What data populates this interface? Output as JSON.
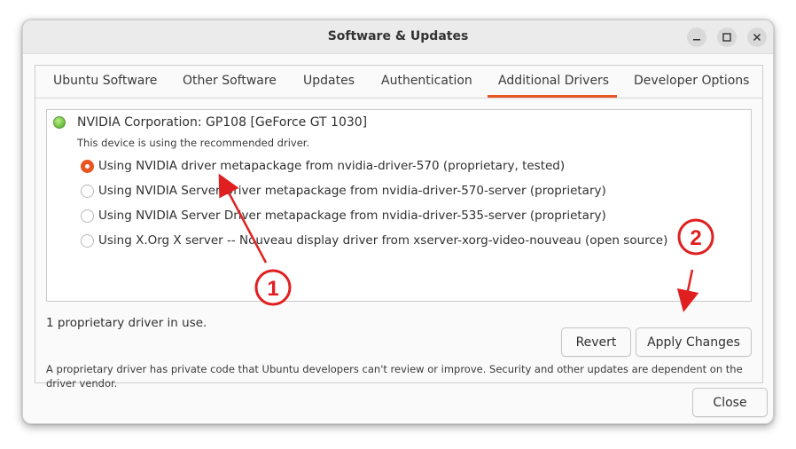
{
  "window": {
    "title": "Software & Updates"
  },
  "tabs": [
    {
      "label": "Ubuntu Software"
    },
    {
      "label": "Other Software"
    },
    {
      "label": "Updates"
    },
    {
      "label": "Authentication"
    },
    {
      "label": "Additional Drivers",
      "selected": true
    },
    {
      "label": "Developer Options"
    }
  ],
  "device": {
    "name": "NVIDIA Corporation: GP108 [GeForce GT 1030]",
    "status": "This device is using the recommended driver.",
    "status_led_color": "#78c74a"
  },
  "driver_options": [
    {
      "label": "Using NVIDIA driver metapackage from nvidia-driver-570 (proprietary, tested)",
      "selected": true
    },
    {
      "label": "Using NVIDIA Server Driver metapackage from nvidia-driver-570-server (proprietary)",
      "selected": false
    },
    {
      "label": "Using NVIDIA Server Driver metapackage from nvidia-driver-535-server (proprietary)",
      "selected": false
    },
    {
      "label": "Using X.Org X server -- Nouveau display driver from xserver-xorg-video-nouveau (open source)",
      "selected": false
    }
  ],
  "status_text": "1 proprietary driver in use.",
  "buttons": {
    "revert": "Revert",
    "apply": "Apply Changes",
    "close": "Close"
  },
  "footnote": "A proprietary driver has private code that Ubuntu developers can't review or improve. Security and other updates are dependent on the driver vendor.",
  "annotations": [
    {
      "label": "1"
    },
    {
      "label": "2"
    }
  ],
  "colors": {
    "accent": "#e95420",
    "annotation": "#e02020"
  },
  "icons": {
    "minimize": "minimize-icon",
    "maximize": "maximize-icon",
    "close": "close-icon"
  }
}
